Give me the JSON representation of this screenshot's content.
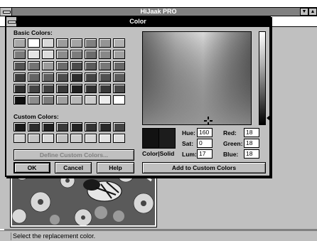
{
  "app": {
    "title": "HiJaak PRO",
    "status": "Select the replacement color."
  },
  "dialog": {
    "title": "Color",
    "basic_colors_label": "Basic Colors:",
    "custom_colors_label": "Custom Colors:",
    "basic_colors": [
      "#a8a8a8",
      "#ffffff",
      "#d8d8d8",
      "#9c9c9c",
      "#a4a4a4",
      "#808080",
      "#949494",
      "#b0b0b0",
      "#7c7c7c",
      "#e4e4e4",
      "#dcdcdc",
      "#8c8c8c",
      "#7c7c7c",
      "#6c6c6c",
      "#888888",
      "#a0a0a0",
      "#545454",
      "#747474",
      "#9c9c9c",
      "#6c6c6c",
      "#4c4c4c",
      "#5c5c5c",
      "#787878",
      "#686868",
      "#3c3c3c",
      "#646464",
      "#606060",
      "#4c4c4c",
      "#2c2c2c",
      "#444444",
      "#505050",
      "#5c5c5c",
      "#2c2c2c",
      "#444444",
      "#404040",
      "#383838",
      "#202020",
      "#303030",
      "#383838",
      "#484848",
      "#101010",
      "#8c8c8c",
      "#7c7c7c",
      "#a0a0a0",
      "#b8b8b8",
      "#cccccc",
      "#ececec",
      "#ffffff"
    ],
    "custom_colors": [
      "#1a1a1a",
      "#2c2c2c",
      "#1f1f1f",
      "#3a3a3a",
      "#242424",
      "#343434",
      "#2a2a2a",
      "#444444",
      "#d0d0d0",
      "#c4c4c4",
      "#d8d8d8",
      "#c0c0c0",
      "#cccccc",
      "#d4d4d4",
      "#e4e4e4",
      "#dcdcdc"
    ],
    "buttons": {
      "define_custom": "Define Custom Colors...",
      "ok": "OK",
      "cancel": "Cancel",
      "help": "Help",
      "add_custom": "Add to Custom Colors"
    },
    "color_solid_label": "Color|Solid",
    "fields": {
      "hue": {
        "label": "Hue:",
        "value": "160"
      },
      "sat": {
        "label": "Sat:",
        "value": "0"
      },
      "lum": {
        "label": "Lum:",
        "value": "17"
      },
      "red": {
        "label": "Red:",
        "value": "18"
      },
      "green": {
        "label": "Green:",
        "value": "18"
      },
      "blue": {
        "label": "Blue:",
        "value": "18"
      }
    }
  },
  "icons": {
    "system_menu": "system-menu-icon",
    "minimize": "minimize-icon",
    "maximize": "maximize-icon",
    "luminance_pointer": "luminance-pointer-icon",
    "crosshair": "color-crosshair-icon"
  }
}
